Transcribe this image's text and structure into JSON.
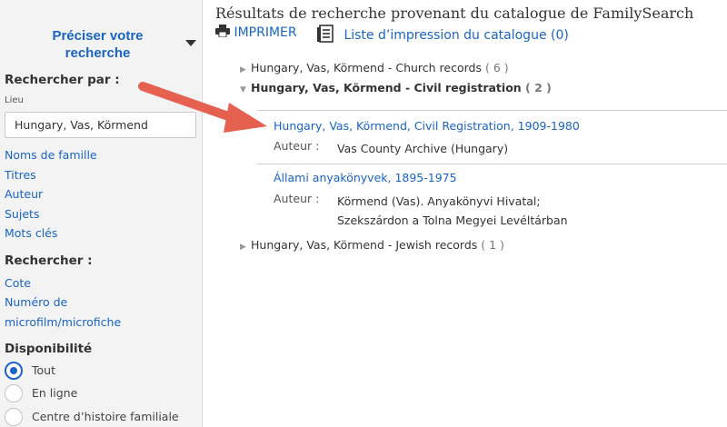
{
  "sidebar": {
    "refine_title": "Préciser votre recherche",
    "search_by_heading": "Rechercher par :",
    "place_label": "Lieu",
    "place_value": "Hungary, Vas, Körmend",
    "links": [
      "Noms de famille",
      "Titres",
      "Auteur",
      "Sujets",
      "Mots clés"
    ],
    "search_heading": "Rechercher :",
    "call_number_link": "Cote",
    "microfilm_link_line1": "Numéro de",
    "microfilm_link_line2": "microfilm/microfiche",
    "availability_heading": "Disponibilité",
    "availability_options": [
      {
        "label": "Tout",
        "checked": true
      },
      {
        "label": "En ligne",
        "checked": false
      },
      {
        "label": "Centre d’histoire familiale",
        "checked": false
      }
    ]
  },
  "main": {
    "title": "Résultats de recherche provenant du catalogue de FamilySearch",
    "print_label": "IMPRIMER",
    "print_list_label": "Liste d’impression du catalogue (0)",
    "groups": [
      {
        "label": "Hungary, Vas, Körmend - Church records",
        "count": "( 6 )",
        "expanded": false
      },
      {
        "label": "Hungary, Vas, Körmend - Civil registration",
        "count": "( 2 )",
        "expanded": true
      },
      {
        "label": "Hungary, Vas, Körmend - Jewish records",
        "count": "( 1 )",
        "expanded": false
      }
    ],
    "records": [
      {
        "title": "Hungary, Vas, Körmend, Civil Registration, 1909-1980",
        "author_label": "Auteur :",
        "author_lines": [
          "Vas County Archive (Hungary)"
        ]
      },
      {
        "title": "Állami anyakönyvek, 1895-1975",
        "author_label": "Auteur :",
        "author_lines": [
          "Körmend (Vas). Anyakönyvi Hivatal;",
          "Szekszárdon a Tolna Megyei Levéltárban"
        ]
      }
    ]
  },
  "colors": {
    "link": "#1a64c6",
    "arrow": "#e5604f",
    "sidebar_bg": "#f3f3f3"
  }
}
